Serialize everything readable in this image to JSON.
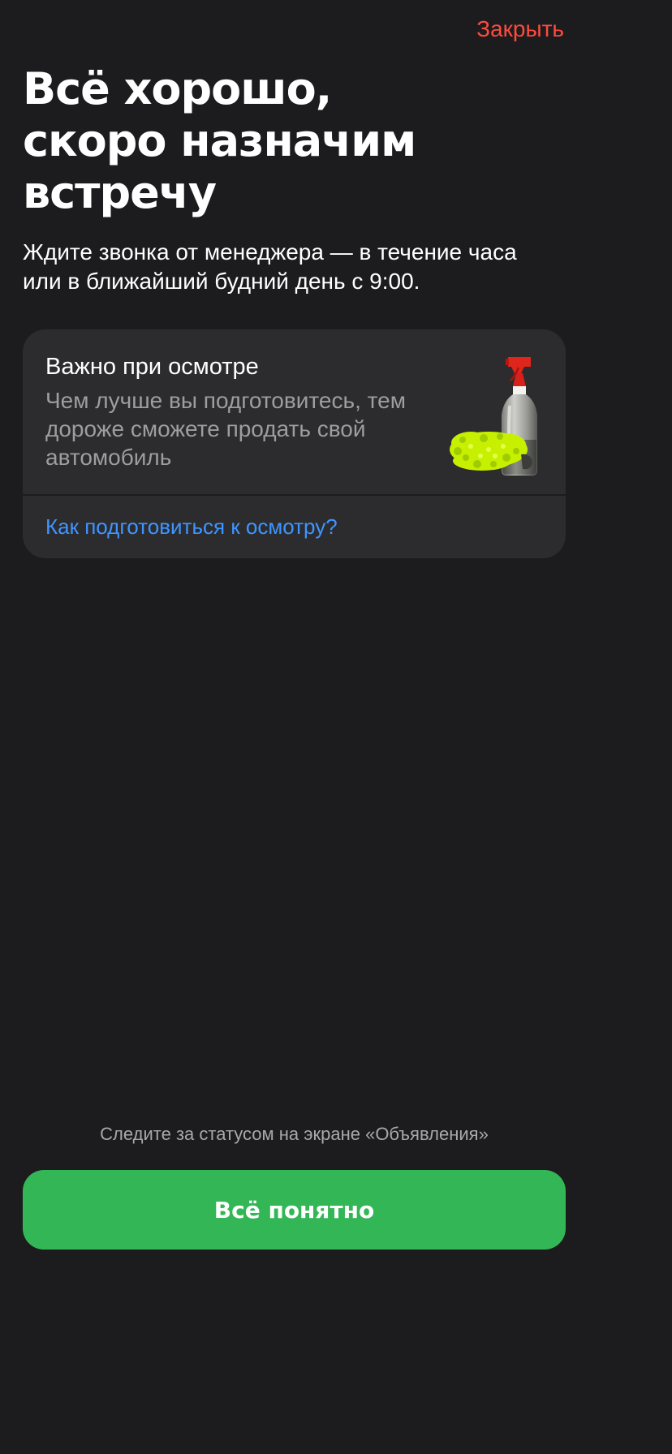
{
  "header": {
    "close_label": "Закрыть",
    "accent_color": "#ff4a3d"
  },
  "hero": {
    "title_lines": [
      "Всё хорошо,",
      "скоро назначим",
      "встречу"
    ],
    "subtitle_lines": [
      "Ждите звонка от менеджера — в течение часа",
      "или в ближайший будний день с 9:00."
    ]
  },
  "card": {
    "title": "Важно при осмотре",
    "text_lines": [
      "Чем лучше вы подготовитесь, тем",
      "дороже сможете продать свой",
      "автомобиль"
    ],
    "image_icon": "spray-bottle-and-microfiber-mitt-icon",
    "link_label": "Как подготовиться к осмотру?",
    "link_color": "#3f95ff"
  },
  "footer": {
    "note": "Следите за статусом на экране «Объявления»",
    "button_label": "Всё понятно",
    "button_color": "#33b756"
  }
}
